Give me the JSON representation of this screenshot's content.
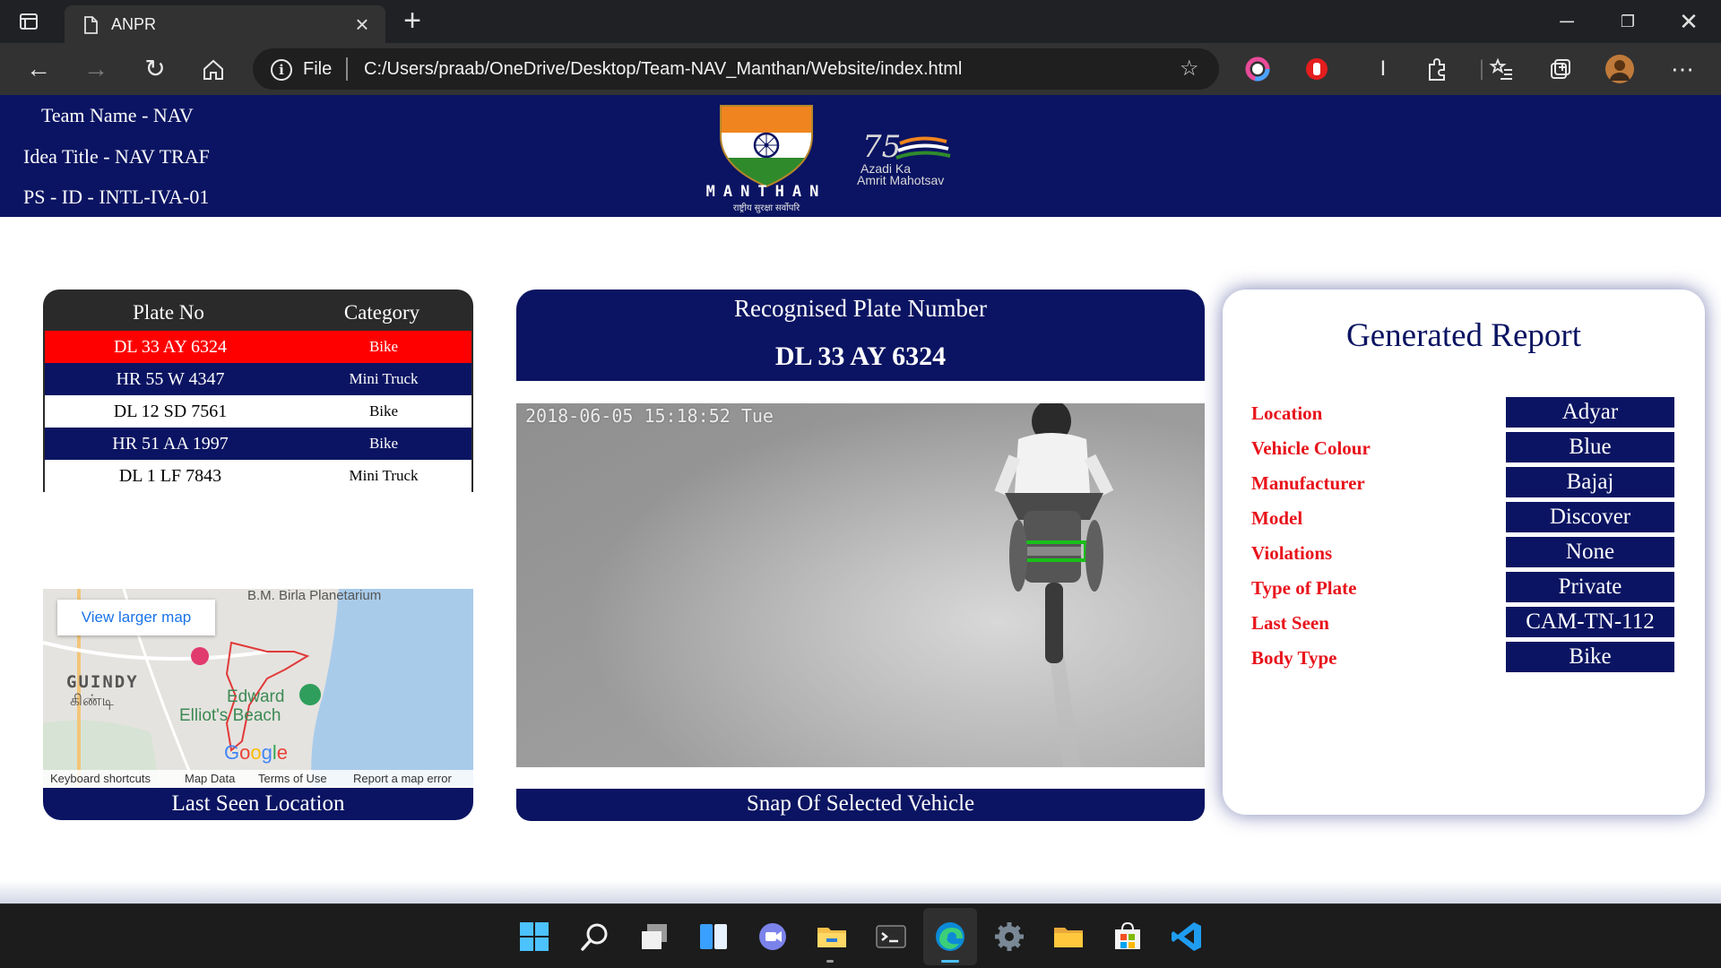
{
  "browser": {
    "tab_title": "ANPR",
    "address_scheme": "File",
    "address_url": "C:/Users/praab/OneDrive/Desktop/Team-NAV_Manthan/Website/index.html"
  },
  "header": {
    "team_name": "Team Name - NAV",
    "idea_title": "Idea Title - NAV TRAF",
    "ps_id": "PS - ID - INTL-IVA-01",
    "logo_title": "MANTHAN",
    "logo_subtitle": "राष्ट्रीय सुरक्षा सर्वोपरि",
    "azadi_number": "75",
    "azadi_line1": "Azadi Ka",
    "azadi_line2": "Amrit Mahotsav"
  },
  "plates": {
    "col_plate": "Plate No",
    "col_category": "Category",
    "rows": [
      {
        "plate": "DL 33 AY 6324",
        "category": "Bike"
      },
      {
        "plate": "HR 55 W 4347",
        "category": "Mini Truck"
      },
      {
        "plate": "DL 12 SD 7561",
        "category": "Bike"
      },
      {
        "plate": "HR 51 AA 1997",
        "category": "Bike"
      },
      {
        "plate": "DL 1 LF 7843",
        "category": "Mini Truck"
      }
    ]
  },
  "map": {
    "view_larger": "View larger map",
    "place_1": "B.M. Birla Planetarium",
    "place_2": "GUINDY",
    "place_2_tamil": "கிண்டி",
    "place_3": "Edward",
    "place_3b": "Elliot's Beach",
    "brand": "Google",
    "footer": [
      "Keyboard shortcuts",
      "Map Data",
      "Terms of Use",
      "Report a map error"
    ],
    "caption": "Last Seen Location"
  },
  "recognition": {
    "title": "Recognised Plate Number",
    "plate": "DL 33 AY 6324",
    "timestamp": "2018-06-05 15:18:52 Tue",
    "caption": "Snap Of Selected Vehicle"
  },
  "report": {
    "title": "Generated Report",
    "fields": [
      {
        "label": "Location",
        "value": "Adyar"
      },
      {
        "label": "Vehicle Colour",
        "value": "Blue"
      },
      {
        "label": "Manufacturer",
        "value": "Bajaj"
      },
      {
        "label": "Model",
        "value": "Discover"
      },
      {
        "label": "Violations",
        "value": "None"
      },
      {
        "label": "Type of Plate",
        "value": "Private"
      },
      {
        "label": "Last Seen",
        "value": "CAM-TN-112"
      },
      {
        "label": "Body Type",
        "value": "Bike"
      }
    ]
  },
  "colors": {
    "navy": "#0b1462",
    "highlight_row": "#ff0000",
    "label_red": "#e8141c"
  },
  "taskbar_icons": [
    "start-icon",
    "search-icon",
    "task-view-icon",
    "widgets-icon",
    "teams-chat-icon",
    "file-explorer-icon",
    "terminal-icon",
    "edge-icon",
    "settings-icon",
    "folder-icon",
    "store-icon",
    "vscode-icon"
  ]
}
